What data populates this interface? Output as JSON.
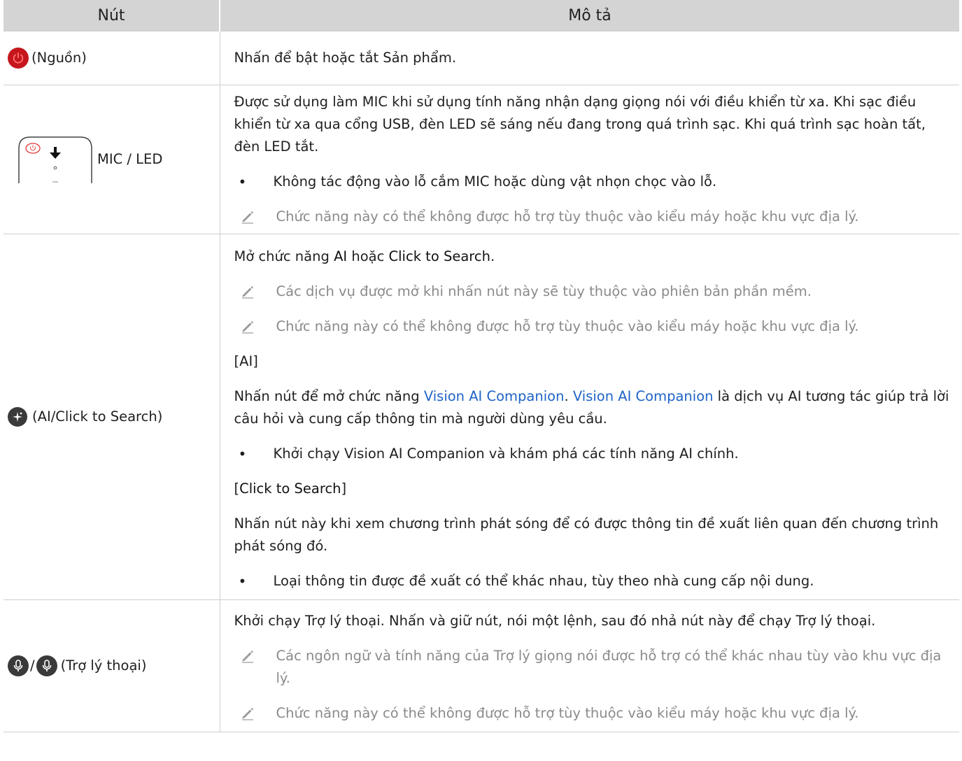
{
  "header": {
    "col1": "Nút",
    "col2": "Mô tả"
  },
  "rows": {
    "power": {
      "label": "(Nguồn)",
      "desc": "Nhấn để bật hoặc tắt Sản phẩm."
    },
    "mic": {
      "label": "MIC / LED",
      "desc": "Được sử dụng làm MIC khi sử dụng tính năng nhận dạng giọng nói với điều khiển từ xa. Khi sạc điều khiển từ xa qua cổng USB, đèn LED sẽ sáng nếu đang trong quá trình sạc. Khi quá trình sạc hoàn tất, đèn LED tắt.",
      "bullet": "Không tác động vào lỗ cắm MIC hoặc dùng vật nhọn chọc vào lỗ.",
      "note": "Chức năng này có thể không được hỗ trợ tùy thuộc vào kiểu máy hoặc khu vực địa lý."
    },
    "ai": {
      "label": "(AI/Click to Search)",
      "intro_pre": "Mở chức năng ",
      "intro_ai": "AI",
      "intro_mid": " hoặc ",
      "intro_cts": "Click to Search",
      "intro_end": ".",
      "note1": "Các dịch vụ được mở khi nhấn nút này sẽ tùy thuộc vào phiên bản phần mềm.",
      "note2": "Chức năng này có thể không được hỗ trợ tùy thuộc vào kiểu máy hoặc khu vực địa lý.",
      "ai_heading": "[AI]",
      "ai_text_pre": "Nhấn nút để mở chức năng ",
      "ai_link1": "Vision AI Companion",
      "ai_text_dot": ". ",
      "ai_link2": "Vision AI Companion",
      "ai_text_post": " là dịch vụ AI tương tác giúp trả lời câu hỏi và cung cấp thông tin mà người dùng yêu cầu.",
      "ai_bullet": "Khởi chạy Vision AI Companion và khám phá các tính năng AI chính.",
      "cts_heading_open": "[",
      "cts_heading_word": "Click to Search",
      "cts_heading_close": "]",
      "cts_text": "Nhấn nút này khi xem chương trình phát sóng để có được thông tin đề xuất liên quan đến chương trình phát sóng đó.",
      "cts_bullet": "Loại thông tin được đề xuất có thể khác nhau, tùy theo nhà cung cấp nội dung."
    },
    "voice": {
      "separator": "/",
      "label": "(Trợ lý thoại)",
      "desc": "Khởi chạy Trợ lý thoại. Nhấn và giữ nút, nói một lệnh, sau đó nhả nút này để chạy Trợ lý thoại.",
      "note1": "Các ngôn ngữ và tính năng của Trợ lý giọng nói được hỗ trợ có thể khác nhau tùy vào khu vực địa lý.",
      "note2": "Chức năng này có thể không được hỗ trợ tùy thuộc vào kiểu máy hoặc khu vực địa lý."
    }
  },
  "bullet_glyph": "•",
  "icons": [
    "power-icon",
    "remote-mic-led-illustration",
    "ai-sparkle-icon",
    "microphone-icon",
    "pencil-note-icon"
  ],
  "colors": {
    "header_bg": "#d4d4d4",
    "power_red": "#c4161c",
    "icon_dark": "#3a3a3a",
    "link": "#1e63c6",
    "note_gray": "#8a8a8a"
  }
}
